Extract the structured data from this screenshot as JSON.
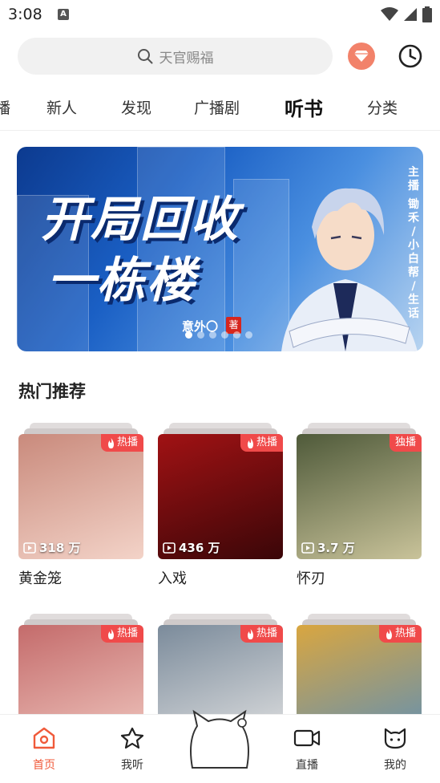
{
  "status": {
    "time": "3:08",
    "notif_badge": "A"
  },
  "search": {
    "placeholder": "天官赐福"
  },
  "tabs": [
    "播",
    "新人",
    "发现",
    "广播剧",
    "听书",
    "分类"
  ],
  "active_tab": "听书",
  "banner": {
    "title_line1": "开局回收",
    "title_line2": "一栋楼",
    "author": "意外〇",
    "seal": "著",
    "vertical_cast_label": "主播",
    "vertical_cast": "锄禾 / 小白帮 / 生话",
    "page_count": 6,
    "active_page": 1
  },
  "section": {
    "title": "热门推荐"
  },
  "cards": [
    {
      "badge": "热播",
      "plays": "318 万",
      "name": "黄金笼",
      "colors": [
        "#c98a7c",
        "#f3d3c8"
      ]
    },
    {
      "badge": "热播",
      "plays": "436 万",
      "name": "入戏",
      "colors": [
        "#a11214",
        "#3a0608"
      ]
    },
    {
      "badge": "独播",
      "plays": "3.7 万",
      "name": "怀刃",
      "colors": [
        "#4f5a3a",
        "#c9c39a"
      ]
    },
    {
      "badge": "热播",
      "plays": "",
      "name": "",
      "colors": [
        "#c46b6b",
        "#f0c8c0"
      ]
    },
    {
      "badge": "热播",
      "plays": "",
      "name": "",
      "colors": [
        "#7b8b9b",
        "#e3e3e3"
      ]
    },
    {
      "badge": "热播",
      "plays": "",
      "name": "",
      "colors": [
        "#d9a640",
        "#5d8fb8"
      ]
    }
  ],
  "nav": [
    {
      "label": "首页",
      "icon": "home-icon",
      "active": true
    },
    {
      "label": "我听",
      "icon": "star-icon",
      "active": false
    },
    {
      "label": "",
      "icon": "cat-mascot-icon",
      "active": false
    },
    {
      "label": "直播",
      "icon": "video-icon",
      "active": false
    },
    {
      "label": "我的",
      "icon": "profile-icon",
      "active": false
    }
  ],
  "colors": {
    "accent": "#f05a3a",
    "badge": "#f04a4a",
    "gem": "#f2826a"
  }
}
